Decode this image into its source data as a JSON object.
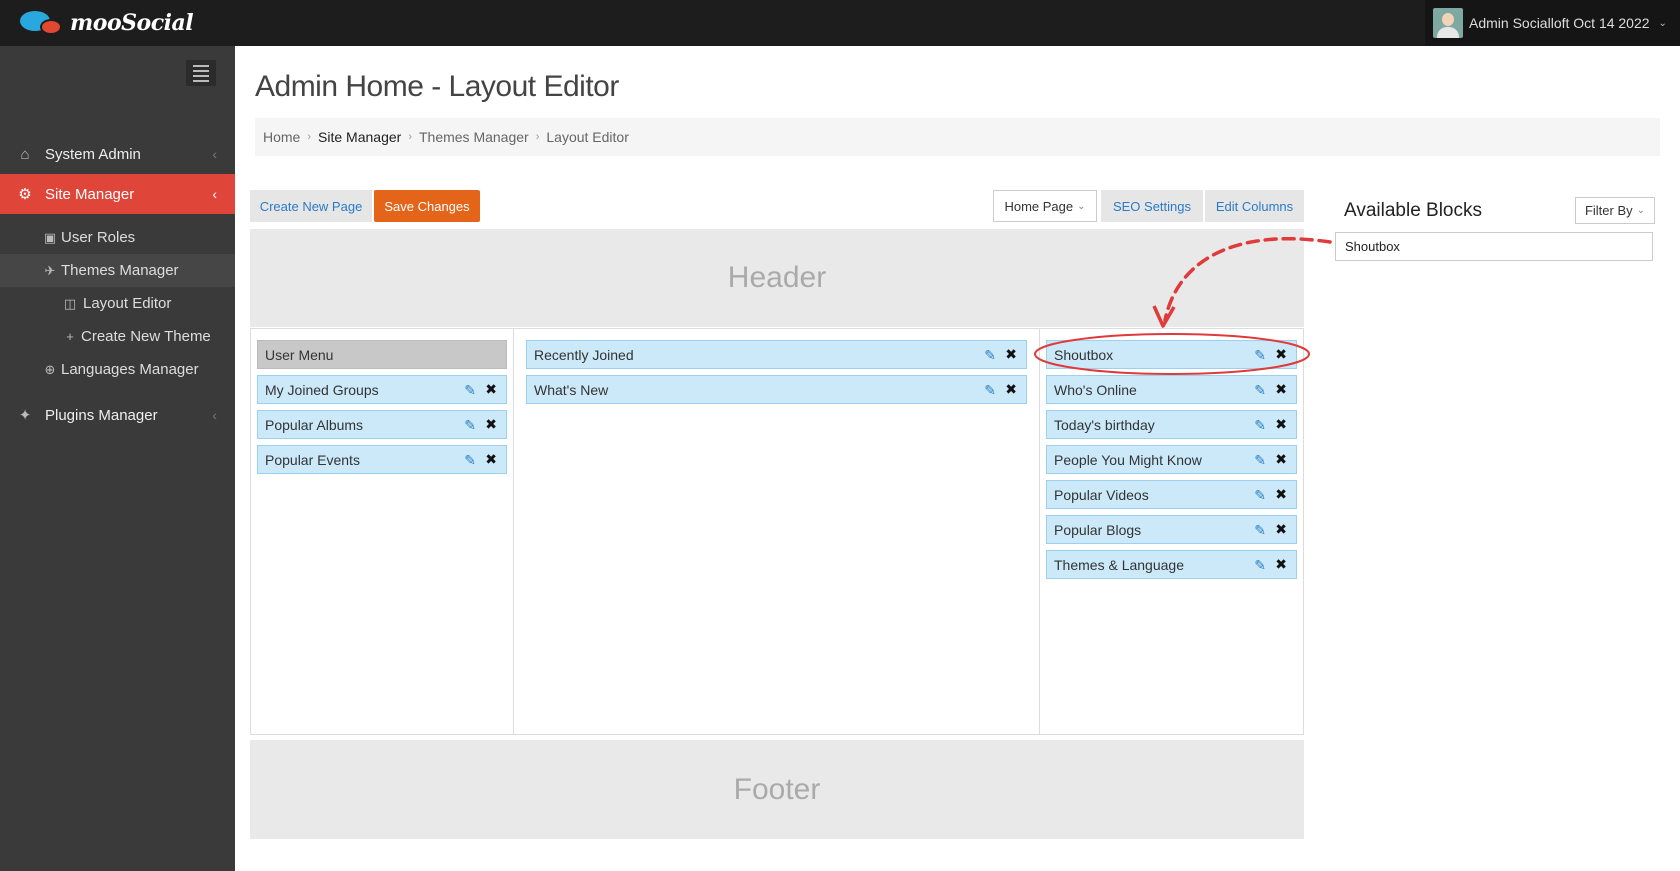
{
  "topbar": {
    "logo_text": "mooSocial",
    "user_name": "Admin Socialloft Oct 14 2022",
    "user_caret": "⌄"
  },
  "sidebar": {
    "items": [
      {
        "label": "System Admin",
        "icon": "home-icon",
        "chevron": "‹"
      },
      {
        "label": "Site Manager",
        "icon": "gears-icon",
        "chevron": "‹",
        "active": true
      },
      {
        "label": "Plugins Manager",
        "icon": "tag-icon",
        "chevron": "‹"
      }
    ],
    "subitems": [
      {
        "label": "User Roles",
        "icon": "briefcase-icon"
      },
      {
        "label": "Themes Manager",
        "icon": "rocket-icon"
      },
      {
        "label": "Layout Editor",
        "icon": "columns-icon"
      },
      {
        "label": "Create New Theme",
        "icon": "plus-icon"
      },
      {
        "label": "Languages Manager",
        "icon": "globe-icon"
      }
    ]
  },
  "page": {
    "title": "Admin Home - Layout Editor",
    "breadcrumb": [
      "Home",
      "Site Manager",
      "Themes Manager",
      "Layout Editor"
    ]
  },
  "toolbar": {
    "create_page": "Create New Page",
    "save_changes": "Save Changes",
    "page_select": "Home Page",
    "page_select_caret": "⌄",
    "seo_settings": "SEO Settings",
    "edit_columns": "Edit Columns"
  },
  "layout": {
    "header_label": "Header",
    "footer_label": "Footer",
    "left_column": [
      "User Menu",
      "My Joined Groups",
      "Popular Albums",
      "Popular Events"
    ],
    "center_column": [
      "Recently Joined",
      "What's New"
    ],
    "right_column": [
      "Shoutbox",
      "Who's Online",
      "Today's birthday",
      "People You Might Know",
      "Popular Videos",
      "Popular Blogs",
      "Themes & Language"
    ],
    "edit_glyph": "✎",
    "delete_glyph": "✖"
  },
  "available": {
    "title": "Available Blocks",
    "filter_label": "Filter By",
    "filter_caret": "⌄",
    "blocks": [
      "Shoutbox"
    ]
  },
  "colors": {
    "sidebar_bg": "#3a3a3a",
    "active_nav": "#e0453a",
    "save_button": "#e4651a",
    "block_bg": "#cce9f9",
    "annotation": "#e03a3a"
  }
}
